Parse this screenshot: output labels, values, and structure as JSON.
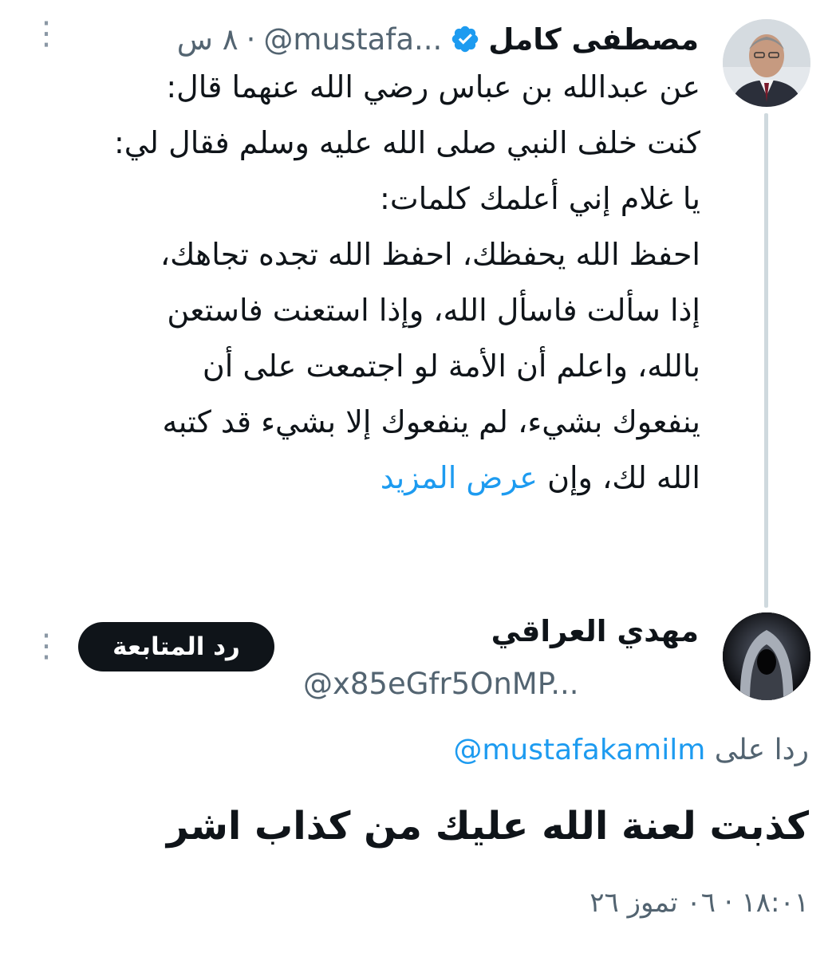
{
  "tweet": {
    "author_name": "مصطفى كامل",
    "handle": "@mustafa...",
    "separator": "·",
    "time": "٨ س",
    "more_icon": "ellipsis-vertical-icon",
    "verified_icon": "verified-badge-icon",
    "verified_color": "#1d9bf0",
    "lines": [
      "عن عبدالله بن عباس رضي الله عنهما قال:",
      "كنت خلف النبي صلى الله عليه وسلم فقال لي:",
      "يا غلام إني أعلمك كلمات:",
      "احفظ الله يحفظك، احفظ الله تجده تجاهك،",
      "إذا سألت فاسأل الله، وإذا استعنت فاستعن",
      "بالله، واعلم أن الأمة لو اجتمعت على أن",
      "ينفعوك بشيء، لم ينفعوك إلا بشيء قد كتبه"
    ],
    "last_line": "الله لك، وإن",
    "show_more": "عرض المزيد"
  },
  "reply": {
    "author_name": "مهدي العراقي",
    "handle": "@x85eGfr5OnMP...",
    "follow_back_label": "رد المتابعة",
    "replying_to_label": "ردا على",
    "replying_to_handle": "@mustafakamilm",
    "text": "كذبت  لعنة الله عليك من كذاب اشر",
    "timestamp": "١٨:٠١ · ٠٦ تموز ٢٦",
    "more_icon": "ellipsis-vertical-icon"
  },
  "colors": {
    "link": "#1d9bf0",
    "secondary_text": "#536471",
    "thread_line": "#cfd9de"
  }
}
